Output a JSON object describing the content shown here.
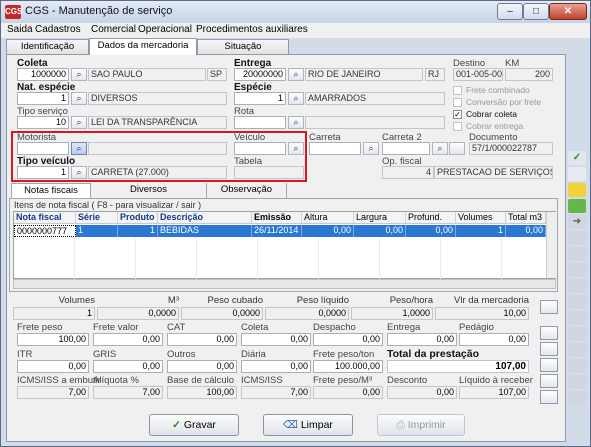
{
  "window": {
    "title": "CGS - Manutenção de serviço",
    "app_icon": "CGS"
  },
  "window_controls": {
    "minimize": "–",
    "maximize": "□",
    "close": "✕"
  },
  "menu": [
    "Saida",
    "Cadastros",
    "Comercial",
    "Operacional",
    "Procedimentos auxiliares"
  ],
  "top_tabs": [
    "Identificação",
    "Dados da mercadoria",
    "Situação"
  ],
  "active_top_tab": "Dados da mercadoria",
  "labels": {
    "coleta": "Coleta",
    "entrega": "Entrega",
    "destino": "Destino",
    "km": "KM",
    "nat_especie": "Nat. espécie",
    "especie": "Espécie",
    "tipo_servico": "Tipo serviço",
    "rota": "Rota",
    "motorista": "Motorista",
    "veiculo": "Veículo",
    "carreta": "Carreta",
    "carreta2": "Carreta 2",
    "documento": "Documento",
    "tipo_veiculo": "Tipo veículo",
    "tabela": "Tabela",
    "op_fiscal": "Op. fiscal"
  },
  "fields": {
    "coleta_code": "1000000",
    "coleta_city": "SAO PAULO",
    "coleta_uf": "SP",
    "entrega_code": "20000000",
    "entrega_city": "RIO DE JANEIRO",
    "entrega_uf": "RJ",
    "destino": "001-005-005",
    "km": "200",
    "nat_especie_code": "1",
    "nat_especie_name": "DIVERSOS",
    "especie_code": "1",
    "especie_name": "AMARRADOS",
    "tipo_servico_code": "10",
    "tipo_servico_name": "LEI DA TRANSPARÊNCIA",
    "rota": "",
    "motorista": "",
    "veiculo": "",
    "carreta": "",
    "carreta2": "",
    "documento": "57/1/000022787",
    "tipo_veiculo_code": "1",
    "tipo_veiculo_name": "CARRETA (27.000)",
    "tabela": "",
    "op_fiscal_code": "4",
    "op_fiscal_name": "PRESTACAO DE SERVIÇOS"
  },
  "checkboxes": [
    {
      "label": "Frete combinado",
      "checked": false,
      "enabled": false
    },
    {
      "label": "Conversão por frete",
      "checked": false,
      "enabled": false
    },
    {
      "label": "Cobrar coleta",
      "checked": true,
      "enabled": true
    },
    {
      "label": "Cobrar entrega",
      "checked": false,
      "enabled": false
    }
  ],
  "mid_tabs": [
    "Notas fiscais",
    "Diversos",
    "Observação"
  ],
  "active_mid_tab": "Notas fiscais",
  "nf_group_title": "Itens de nota fiscal ( F8 - para visualizar / sair )",
  "nf_table": {
    "headers": [
      "Nota fiscal",
      "Série",
      "Produto",
      "Descrição",
      "Emissão",
      "Altura",
      "Largura",
      "Profund.",
      "Volumes",
      "Total m3"
    ],
    "rows": [
      [
        "0000000777",
        "1",
        "1",
        "BEBIDAS",
        "26/11/2014",
        "0,00",
        "0,00",
        "0,00",
        "1",
        "0,00"
      ]
    ]
  },
  "totals": {
    "headers": [
      "Volumes",
      "M³",
      "Peso cubado",
      "Peso líquido",
      "Peso/hora",
      "Vlr da mercadoria"
    ],
    "values": [
      "1",
      "0,0000",
      "0,0000",
      "0,0000",
      "1,0000",
      "10,00"
    ]
  },
  "freight": {
    "row1_labels": [
      "Frete peso",
      "Frete valor",
      "CAT",
      "Coleta",
      "Despacho",
      "Entrega",
      "Pedágio"
    ],
    "row1_values": [
      "100,00",
      "0,00",
      "0,00",
      "0,00",
      "0,00",
      "0,00",
      "0,00"
    ],
    "row2_labels": [
      "ITR",
      "GRIS",
      "Outros",
      "Diária",
      "Frete peso/ton",
      "Total da prestação"
    ],
    "row2_values": [
      "0,00",
      "0,00",
      "0,00",
      "0,00",
      "100.000,00",
      "107,00"
    ],
    "row3_labels": [
      "ICMS/ISS a embutir",
      "Alíquota %",
      "Base de cálculo",
      "ICMS/ISS",
      "Frete peso/M³",
      "Desconto",
      "Líquido à receber"
    ],
    "row3_values": [
      "7,00",
      "7,00",
      "100,00",
      "7,00",
      "0,00",
      "0,00",
      "107,00"
    ]
  },
  "buttons": {
    "save": "Gravar",
    "clear": "Limpar",
    "print": "Imprimir"
  },
  "icons": {
    "binoculars": "⌕",
    "check": "✓",
    "arrow": "➔"
  },
  "colors": {
    "highlight": "#e0141e",
    "selection": "#2a78d2",
    "titlebar": "#c5d3e8"
  }
}
